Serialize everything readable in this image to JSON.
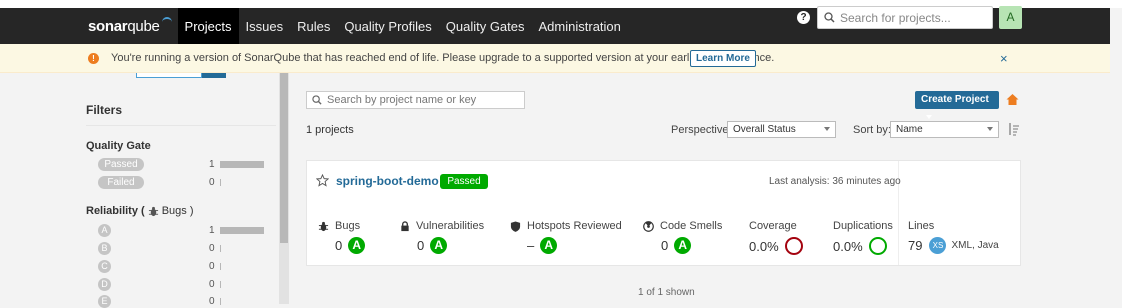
{
  "nav": {
    "logo_bold": "sonar",
    "logo_rest": "qube",
    "items": [
      "Projects",
      "Issues",
      "Rules",
      "Quality Profiles",
      "Quality Gates",
      "Administration"
    ],
    "active": "Projects",
    "help": "?",
    "search_placeholder": "Search for projects...",
    "avatar": "A"
  },
  "banner": {
    "message": "You're running a version of SonarQube that has reached end of life. Please upgrade to a supported version at your earliest convenience.",
    "learn_more": "Learn More",
    "close": "×"
  },
  "filters": {
    "title": "Filters",
    "quality_gate": {
      "label": "Quality Gate",
      "options": [
        {
          "label": "Passed",
          "count": "1",
          "fill": 1.0
        },
        {
          "label": "Failed",
          "count": "0",
          "fill": 0
        }
      ]
    },
    "reliability": {
      "label": "Reliability (",
      "icon": "bug-icon",
      "label_suffix": "Bugs )",
      "options": [
        {
          "label": "A",
          "count": "1",
          "fill": 1.0
        },
        {
          "label": "B",
          "count": "0",
          "fill": 0
        },
        {
          "label": "C",
          "count": "0",
          "fill": 0
        },
        {
          "label": "D",
          "count": "0",
          "fill": 0
        },
        {
          "label": "E",
          "count": "0",
          "fill": 0
        }
      ]
    }
  },
  "toolbar": {
    "search_placeholder": "Search by project name or key",
    "create_project": "Create Project",
    "project_count": "1 projects",
    "perspective_label": "Perspective:",
    "perspective_value": "Overall Status",
    "sort_label": "Sort by:",
    "sort_value": "Name"
  },
  "project": {
    "name": "spring-boot-demo",
    "status": "Passed",
    "last_analysis": "Last analysis: 36 minutes ago",
    "metrics": {
      "bugs": {
        "label": "Bugs",
        "value": "0",
        "grade": "A"
      },
      "vulnerabilities": {
        "label": "Vulnerabilities",
        "value": "0",
        "grade": "A"
      },
      "hotspots": {
        "label": "Hotspots Reviewed",
        "value": "–",
        "grade": "A"
      },
      "code_smells": {
        "label": "Code Smells",
        "value": "0",
        "grade": "A"
      },
      "coverage": {
        "label": "Coverage",
        "value": "0.0%",
        "percent": 0
      },
      "duplications": {
        "label": "Duplications",
        "value": "0.0%",
        "percent": 0
      },
      "lines": {
        "label": "Lines",
        "value": "79",
        "size": "XS",
        "languages": "XML, Java"
      }
    }
  },
  "footer": "1 of 1 shown",
  "colors": {
    "nav_bg": "#262626",
    "accent": "#236a97",
    "passed": "#00aa00",
    "coverage_ring": "#a4030f",
    "duplication_ring": "#00aa00",
    "warning": "#ed7d20"
  }
}
